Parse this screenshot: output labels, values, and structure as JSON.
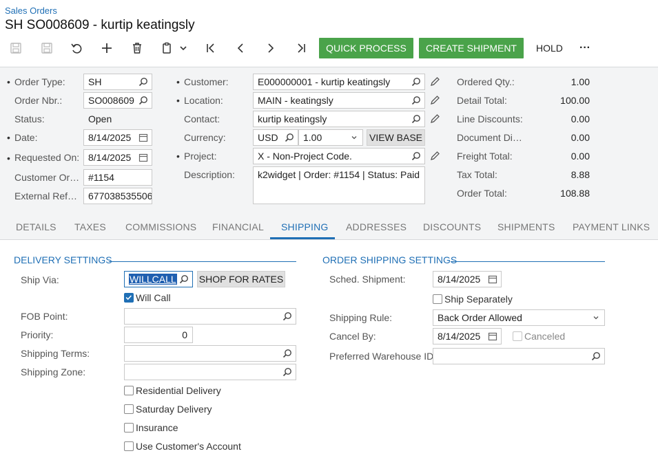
{
  "header": {
    "breadcrumb": "Sales Orders",
    "title": "SH SO008609 - kurtip keatingsly"
  },
  "toolbar": {
    "icons": [
      "save-icon",
      "save-close-icon",
      "undo-icon",
      "add-icon",
      "delete-icon",
      "copy-paste-icon",
      "first-icon",
      "previous-icon",
      "next-icon",
      "last-icon"
    ],
    "quick_process": "QUICK PROCESS",
    "create_shipment": "CREATE SHIPMENT",
    "hold": "HOLD",
    "more": "···"
  },
  "summary": {
    "order_type": {
      "label": "Order Type:",
      "value": "SH"
    },
    "order_nbr": {
      "label": "Order Nbr.:",
      "value": "SO008609"
    },
    "status": {
      "label": "Status:",
      "value": "Open"
    },
    "date": {
      "label": "Date:",
      "value": "8/14/2025"
    },
    "requested_on": {
      "label": "Requested On:",
      "value": "8/14/2025"
    },
    "customer_ord": {
      "label": "Customer Ord...",
      "value": "#1154"
    },
    "external_ref": {
      "label": "External Refer...",
      "value": "677038535506"
    },
    "customer": {
      "label": "Customer:",
      "value": "E000000001 - kurtip keatingsly"
    },
    "location": {
      "label": "Location:",
      "value": "MAIN - keatingsly"
    },
    "contact": {
      "label": "Contact:",
      "value": "kurtip keatingsly"
    },
    "currency": {
      "label": "Currency:",
      "value": "USD",
      "rate": "1.00",
      "view_base": "VIEW BASE"
    },
    "project": {
      "label": "Project:",
      "value": "X - Non-Project Code."
    },
    "description": {
      "label": "Description:",
      "value": "k2widget | Order: #1154 | Status: Paid"
    },
    "totals": [
      {
        "label": "Ordered Qty.:",
        "value": "1.00"
      },
      {
        "label": "Detail Total:",
        "value": "100.00"
      },
      {
        "label": "Line Discounts:",
        "value": "0.00"
      },
      {
        "label": "Document Dis...",
        "value": "0.00"
      },
      {
        "label": "Freight Total:",
        "value": "0.00"
      },
      {
        "label": "Tax Total:",
        "value": "8.88"
      },
      {
        "label": "Order Total:",
        "value": "108.88"
      }
    ]
  },
  "tabs": [
    "DETAILS",
    "TAXES",
    "COMMISSIONS",
    "FINANCIAL",
    "SHIPPING",
    "ADDRESSES",
    "DISCOUNTS",
    "SHIPMENTS",
    "PAYMENT LINKS"
  ],
  "active_tab": "SHIPPING",
  "delivery": {
    "title": "DELIVERY SETTINGS",
    "ship_via": {
      "label": "Ship Via:",
      "value": "WILLCALL",
      "button": "SHOP FOR RATES"
    },
    "will_call": {
      "label": "Will Call",
      "checked": true
    },
    "fob_point": {
      "label": "FOB Point:",
      "value": ""
    },
    "priority": {
      "label": "Priority:",
      "value": "0"
    },
    "shipping_terms": {
      "label": "Shipping Terms:",
      "value": ""
    },
    "shipping_zone": {
      "label": "Shipping Zone:",
      "value": ""
    },
    "residential": {
      "label": "Residential Delivery",
      "checked": false
    },
    "saturday": {
      "label": "Saturday Delivery",
      "checked": false
    },
    "insurance": {
      "label": "Insurance",
      "checked": false
    },
    "use_customer_account": {
      "label": "Use Customer's Account",
      "checked": false
    }
  },
  "order_shipping": {
    "title": "ORDER SHIPPING SETTINGS",
    "sched_shipment": {
      "label": "Sched. Shipment:",
      "value": "8/14/2025"
    },
    "ship_separately": {
      "label": "Ship Separately",
      "checked": false
    },
    "shipping_rule": {
      "label": "Shipping Rule:",
      "value": "Back Order Allowed"
    },
    "cancel_by": {
      "label": "Cancel By:",
      "value": "8/14/2025"
    },
    "canceled": {
      "label": "Canceled",
      "checked": false
    },
    "preferred_warehouse": {
      "label": "Preferred Warehouse ID:",
      "value": ""
    }
  },
  "colors": {
    "accent": "#1f6fb5",
    "green": "#4aa34a",
    "panel": "#f3f4f5"
  }
}
